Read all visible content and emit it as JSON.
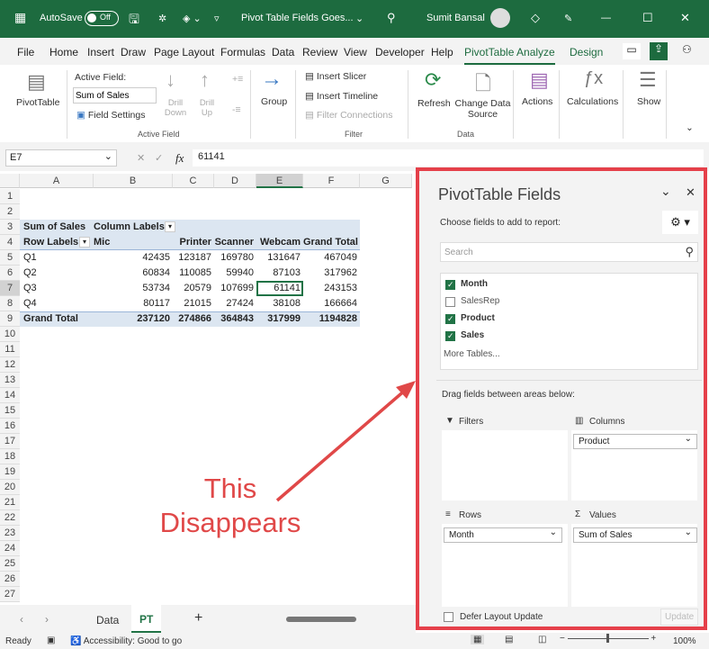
{
  "titlebar": {
    "autosave": "AutoSave",
    "toggle": "Off",
    "doc_title": "Pivot Table Fields Goes...",
    "user": "Sumit Bansal"
  },
  "tabs": [
    "File",
    "Home",
    "Insert",
    "Draw",
    "Page Layout",
    "Formulas",
    "Data",
    "Review",
    "View",
    "Developer",
    "Help",
    "PivotTable Analyze",
    "Design"
  ],
  "ribbon": {
    "pivottable": "PivotTable",
    "active_field_label": "Active Field:",
    "active_field_value": "Sum of Sales",
    "field_settings": "Field Settings",
    "drill_down": "Drill Down",
    "drill_up": "Drill Up",
    "group": "Group",
    "insert_slicer": "Insert Slicer",
    "insert_timeline": "Insert Timeline",
    "filter_connections": "Filter Connections",
    "refresh": "Refresh",
    "change_data_source": "Change Data Source",
    "actions": "Actions",
    "calculations": "Calculations",
    "show": "Show",
    "groups": {
      "active_field": "Active Field",
      "filter": "Filter",
      "data": "Data"
    }
  },
  "formula_bar": {
    "name_box": "E7",
    "fx": "fx",
    "value": "61141"
  },
  "sheet": {
    "columns": [
      "A",
      "B",
      "C",
      "D",
      "E",
      "F",
      "G"
    ],
    "rows": [
      "1",
      "2",
      "3",
      "4",
      "5",
      "6",
      "7",
      "8",
      "9",
      "10",
      "11",
      "12",
      "13",
      "14",
      "15",
      "16",
      "17",
      "18",
      "19",
      "20",
      "21",
      "22",
      "23",
      "24",
      "25",
      "26",
      "27"
    ],
    "pivot": {
      "sum_label": "Sum of Sales",
      "column_labels": "Column Labels",
      "row_labels": "Row Labels",
      "headers": [
        "Mic",
        "Printer",
        "Scanner",
        "Webcam",
        "Grand Total"
      ],
      "data": [
        [
          "Q1",
          "42435",
          "123187",
          "169780",
          "131647",
          "467049"
        ],
        [
          "Q2",
          "60834",
          "110085",
          "59940",
          "87103",
          "317962"
        ],
        [
          "Q3",
          "53734",
          "20579",
          "107699",
          "61141",
          "243153"
        ],
        [
          "Q4",
          "80117",
          "21015",
          "27424",
          "38108",
          "166664"
        ]
      ],
      "total": [
        "Grand Total",
        "237120",
        "274866",
        "364843",
        "317999",
        "1194828"
      ]
    }
  },
  "panel": {
    "title": "PivotTable Fields",
    "choose": "Choose fields to add to report:",
    "search_placeholder": "Search",
    "fields": [
      {
        "label": "Month",
        "checked": true
      },
      {
        "label": "SalesRep",
        "checked": false
      },
      {
        "label": "Product",
        "checked": true
      },
      {
        "label": "Sales",
        "checked": true
      }
    ],
    "more_tables": "More Tables...",
    "drag": "Drag fields between areas below:",
    "filters": "Filters",
    "columns": "Columns",
    "rows": "Rows",
    "values": "Values",
    "columns_item": "Product",
    "rows_item": "Month",
    "values_item": "Sum of Sales",
    "defer": "Defer Layout Update",
    "update": "Update"
  },
  "sheet_tabs": [
    "Data",
    "PT"
  ],
  "status": {
    "ready": "Ready",
    "accessibility": "Accessibility: Good to go",
    "zoom": "100%"
  },
  "annotation": {
    "line1": "This",
    "line2": "Disappears",
    "color": "#e04848"
  }
}
